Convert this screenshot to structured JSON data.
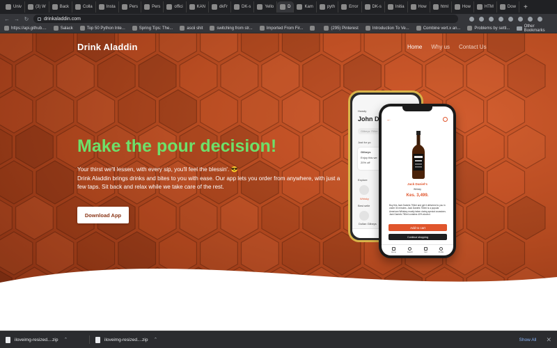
{
  "browser": {
    "tabs": [
      "Univ",
      "(3) W",
      "Back",
      "Colla",
      "Insta",
      "Pers",
      "Pers",
      "offici",
      "KAN",
      "dkFr",
      "DK-s",
      "Yello",
      "D",
      "Kam",
      "pyth",
      "Error",
      "DK-s",
      "Initia",
      "How",
      "html",
      "How",
      "HTM",
      "Dow"
    ],
    "active_tab_index": 12,
    "new_tab_label": "+",
    "url": "drinkaladdin.com",
    "bookmarks": [
      "https://api.github....",
      "Salack",
      "Top 50 Python Inte...",
      "Spring Tips: The...",
      "ascii shit",
      "switching from str...",
      "Imported From Fir...",
      "",
      "(295) Pinterest",
      "Introduction To Ve...",
      "Combine vert.x an...",
      "Problems by setti..."
    ],
    "other_bookmarks": "Other Bookmarks"
  },
  "site": {
    "brand": "Drink Aladdin",
    "nav": [
      "Home",
      "Why us",
      "Contact Us"
    ],
    "headline": "Make the pour decision!",
    "subtext_line1": "Your thirst we'll lessen, with every sip, you'll feel the blessin'. 😎",
    "subtext_line2": "Drink Aladdin brings drinks and bites to you with ease. Our app lets you order from anywhere, with just a few taps. Sit back and relax while we take care of the rest.",
    "cta": "Download App",
    "colors": {
      "hero": "#b44a20",
      "headline": "#6ee06a",
      "accent": "#e0552c"
    }
  },
  "phone_back": {
    "greeting": "Howdy",
    "title": "John D",
    "search": "Gilbeys 750m",
    "section": "Just for yo",
    "card_title": "Gilbeys",
    "card_text": "Enjoy this we",
    "card_discount": "20% off",
    "explore": "Explore",
    "explore_item": "Whisky",
    "best": "Best selle",
    "best_item": "Dollan Gilbeys"
  },
  "phone_front": {
    "product_name": "Jack Daniel's",
    "category": "Whisky",
    "price": "Kes. 3,499.",
    "description": "Buy this Jack Daniels 750ml and get it delivered to you in under 30 minutes. Jack Daniels 750ml is a popular American Whiskey mostly taken during special occasions. Jack Daniels 750ml contains 40% alcohol.",
    "add_to_cart": "Add to cart",
    "continue": "Continue shopping",
    "tabs": [
      "Home",
      "Search",
      "Cart",
      "Profile"
    ]
  },
  "downloads": {
    "items": [
      "iloveimg-resized....zip",
      "iloveimg-resized....zip"
    ],
    "show_all": "Show All"
  }
}
